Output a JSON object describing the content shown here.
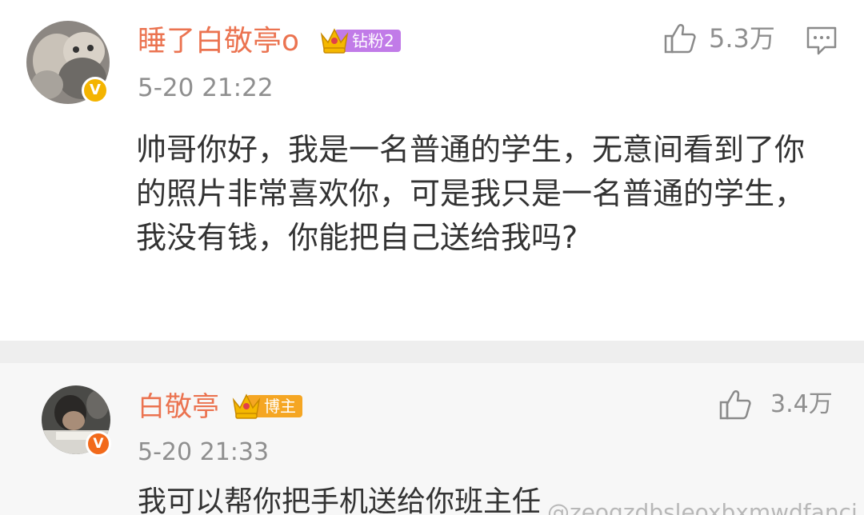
{
  "comments": [
    {
      "username": "睡了白敬亭o",
      "tag": "钻粉2",
      "time": "5-20 21:22",
      "likes": "5.3万",
      "text": "帅哥你好，我是一名普通的学生，无意间看到了你的照片非常喜欢你，可是我只是一名普通的学生，我没有钱，你能把自己送给我吗?",
      "verified_badge": "V",
      "icons": [
        "avatar",
        "verified-badge",
        "crown-icon",
        "thumbs-up-icon",
        "reply-icon"
      ],
      "colors": {
        "username": "#eb7350",
        "tag": "#c17be8",
        "badge": "#f4b400"
      }
    },
    {
      "username": "白敬亭",
      "tag": "博主",
      "time": "5-20 21:33",
      "likes": "3.4万",
      "text": "我可以帮你把手机送给你班主任",
      "verified_badge": "V",
      "icons": [
        "avatar",
        "verified-badge",
        "crown-icon",
        "thumbs-up-icon"
      ],
      "colors": {
        "username": "#eb7350",
        "tag": "#f5a623",
        "badge": "#f26a1b"
      }
    }
  ],
  "watermark": "@zeogzdbsleoxbxmwdfanci"
}
